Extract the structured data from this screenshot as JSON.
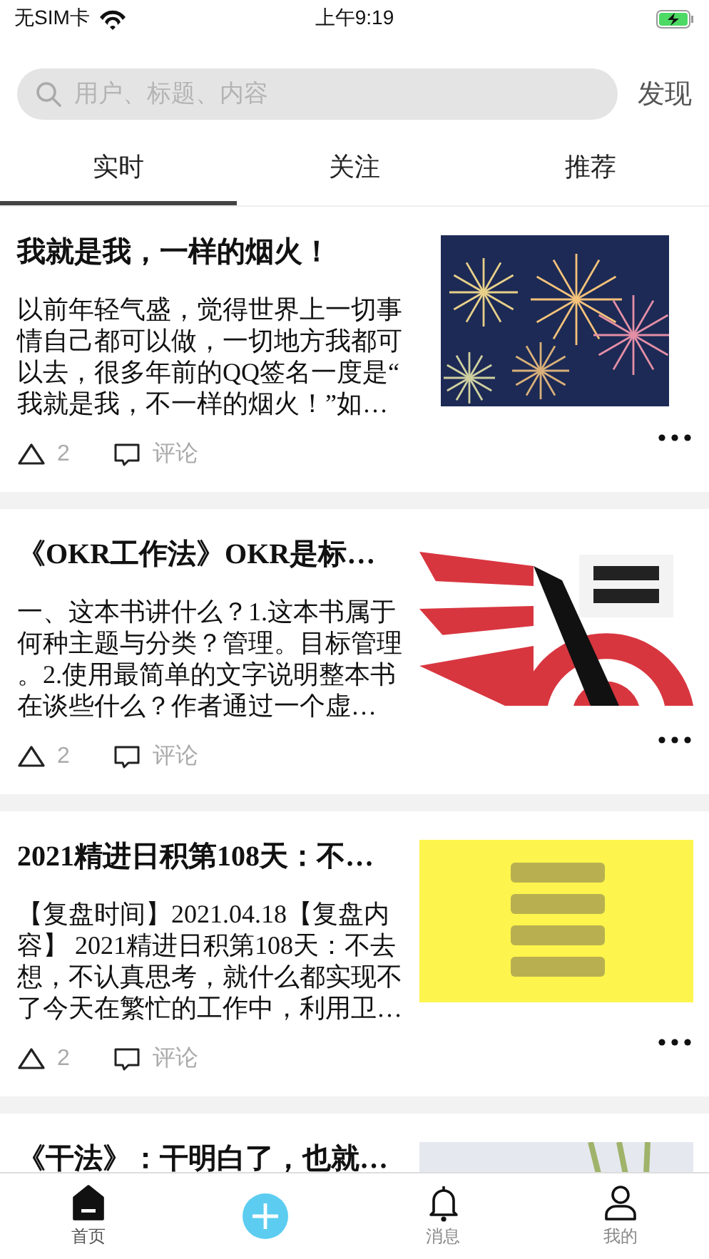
{
  "status_bar": {
    "carrier": "无SIM卡",
    "time": "上午9:19"
  },
  "search": {
    "placeholder": "用户、标题、内容",
    "action": "发现"
  },
  "tabs": [
    {
      "label": "实时",
      "selected": true
    },
    {
      "label": "关注",
      "selected": false
    },
    {
      "label": "推荐",
      "selected": false
    }
  ],
  "posts": [
    {
      "title": "我就是我，一样的烟火！",
      "body": "以前年轻气盛，觉得世界上一切事情自己都可以做，一切地方我都可以去，很多年前的QQ签名一度是“我就是我，不一样的烟火！”如…",
      "likes": "2",
      "comment": "评论"
    },
    {
      "title": "《OKR工作法》OKR是标…",
      "body": "一、这本书讲什么？1.这本书属于何种主题与分类？管理。目标管理。2.使用最简单的文字说明整本书在谈些什么？作者通过一个虚…",
      "likes": "2",
      "comment": "评论"
    },
    {
      "title": "2021精进日积第108天：不…",
      "body": "【复盘时间】2021.04.18【复盘内容】 2021精进日积第108天：不去想，不认真思考，就什么都实现不了今天在繁忙的工作中，利用卫…",
      "likes": "2",
      "comment": "评论"
    },
    {
      "title": "《干法》：干明白了，也就…"
    }
  ],
  "tab_bar": [
    {
      "kind": "home",
      "label": "首页",
      "selected": true
    },
    {
      "kind": "add"
    },
    {
      "kind": "bell",
      "label": "消息",
      "selected": false
    },
    {
      "kind": "person",
      "label": "我的",
      "selected": false
    }
  ]
}
